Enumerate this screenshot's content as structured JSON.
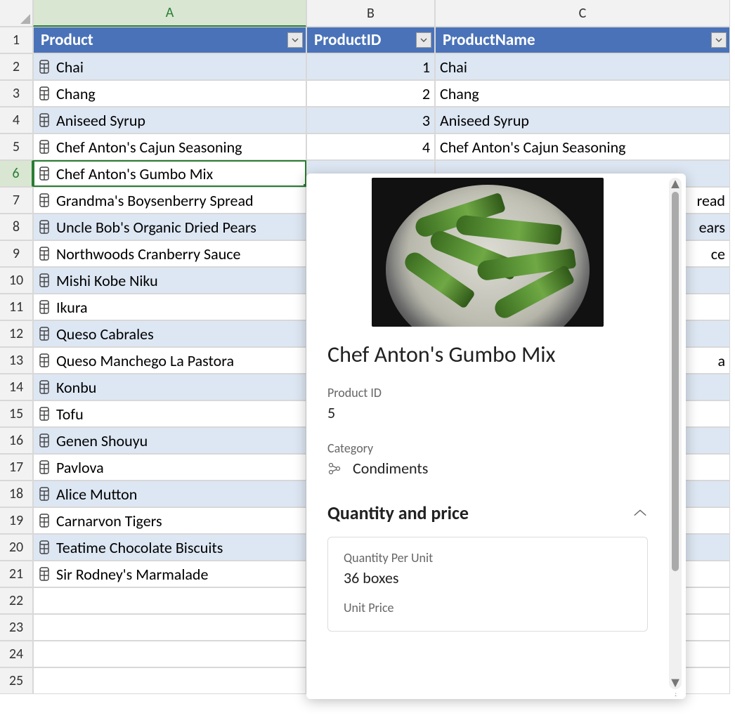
{
  "columns": [
    "A",
    "B",
    "C"
  ],
  "headers": {
    "A": "Product",
    "B": "ProductID",
    "C": "ProductName"
  },
  "selected_row": 6,
  "rows": [
    {
      "n": 1,
      "header": true
    },
    {
      "n": 2,
      "product": "Chai",
      "id": "1",
      "name": "Chai"
    },
    {
      "n": 3,
      "product": "Chang",
      "id": "2",
      "name": "Chang"
    },
    {
      "n": 4,
      "product": "Aniseed Syrup",
      "id": "3",
      "name": "Aniseed Syrup"
    },
    {
      "n": 5,
      "product": "Chef Anton's Cajun Seasoning",
      "id": "4",
      "name": "Chef Anton's Cajun Seasoning"
    },
    {
      "n": 6,
      "product": "Chef Anton's Gumbo Mix",
      "id": "",
      "name": ""
    },
    {
      "n": 7,
      "product": "Grandma's Boysenberry Spread",
      "id": "",
      "name_suffix": "read"
    },
    {
      "n": 8,
      "product": "Uncle Bob's Organic Dried Pears",
      "id": "",
      "name_suffix": "ears"
    },
    {
      "n": 9,
      "product": "Northwoods Cranberry Sauce",
      "id": "",
      "name_suffix": "ce"
    },
    {
      "n": 10,
      "product": "Mishi Kobe Niku",
      "id": "",
      "name": ""
    },
    {
      "n": 11,
      "product": "Ikura",
      "id": "",
      "name": ""
    },
    {
      "n": 12,
      "product": "Queso Cabrales",
      "id": "",
      "name": ""
    },
    {
      "n": 13,
      "product": "Queso Manchego La Pastora",
      "id": "",
      "name_suffix": "a"
    },
    {
      "n": 14,
      "product": "Konbu",
      "id": "",
      "name": ""
    },
    {
      "n": 15,
      "product": "Tofu",
      "id": "",
      "name": ""
    },
    {
      "n": 16,
      "product": "Genen Shouyu",
      "id": "",
      "name": ""
    },
    {
      "n": 17,
      "product": "Pavlova",
      "id": "",
      "name": ""
    },
    {
      "n": 18,
      "product": "Alice Mutton",
      "id": "",
      "name": ""
    },
    {
      "n": 19,
      "product": "Carnarvon Tigers",
      "id": "",
      "name": ""
    },
    {
      "n": 20,
      "product": "Teatime Chocolate Biscuits",
      "id": "",
      "name": ""
    },
    {
      "n": 21,
      "product": "Sir Rodney's Marmalade",
      "id": "",
      "name": ""
    },
    {
      "n": 22,
      "empty": true
    },
    {
      "n": 23,
      "empty": true
    },
    {
      "n": 24,
      "empty": true
    },
    {
      "n": 25,
      "empty": true
    }
  ],
  "card": {
    "title": "Chef Anton's Gumbo Mix",
    "product_id_label": "Product ID",
    "product_id_value": "5",
    "category_label": "Category",
    "category_value": "Condiments",
    "section_title": "Quantity and price",
    "qpu_label": "Quantity Per Unit",
    "qpu_value": "36 boxes",
    "unit_price_label": "Unit Price"
  }
}
